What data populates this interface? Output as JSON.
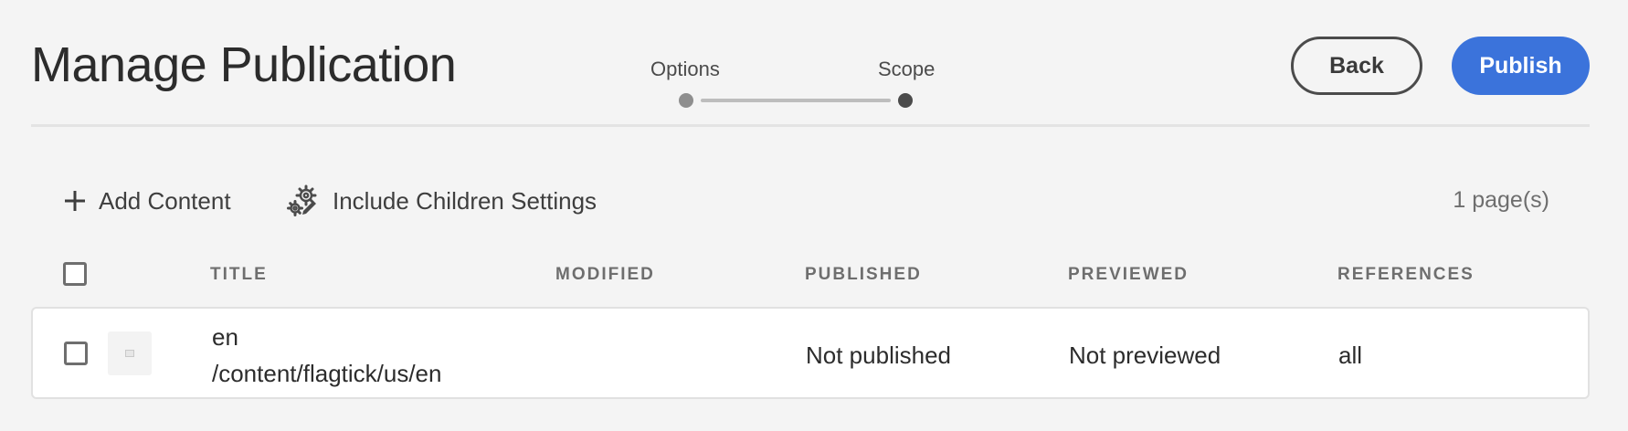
{
  "header": {
    "title": "Manage Publication",
    "back_label": "Back",
    "publish_label": "Publish",
    "accent_color": "#3b73db"
  },
  "wizard": {
    "steps": [
      {
        "label": "Options",
        "state": "done"
      },
      {
        "label": "Scope",
        "state": "current"
      }
    ]
  },
  "toolbar": {
    "add_content_label": "Add Content",
    "add_content_icon": "plus-icon",
    "include_children_label": "Include Children Settings",
    "include_children_icon": "gears-icon",
    "page_count": "1 page(s)"
  },
  "table": {
    "columns": [
      "TITLE",
      "MODIFIED",
      "PUBLISHED",
      "PREVIEWED",
      "REFERENCES"
    ],
    "rows": [
      {
        "checked": false,
        "thumbnail": "page-thumbnail-icon",
        "title": "en",
        "path": "/content/flagtick/us/en",
        "modified": "",
        "published": "Not published",
        "previewed": "Not previewed",
        "references": "all"
      }
    ]
  }
}
